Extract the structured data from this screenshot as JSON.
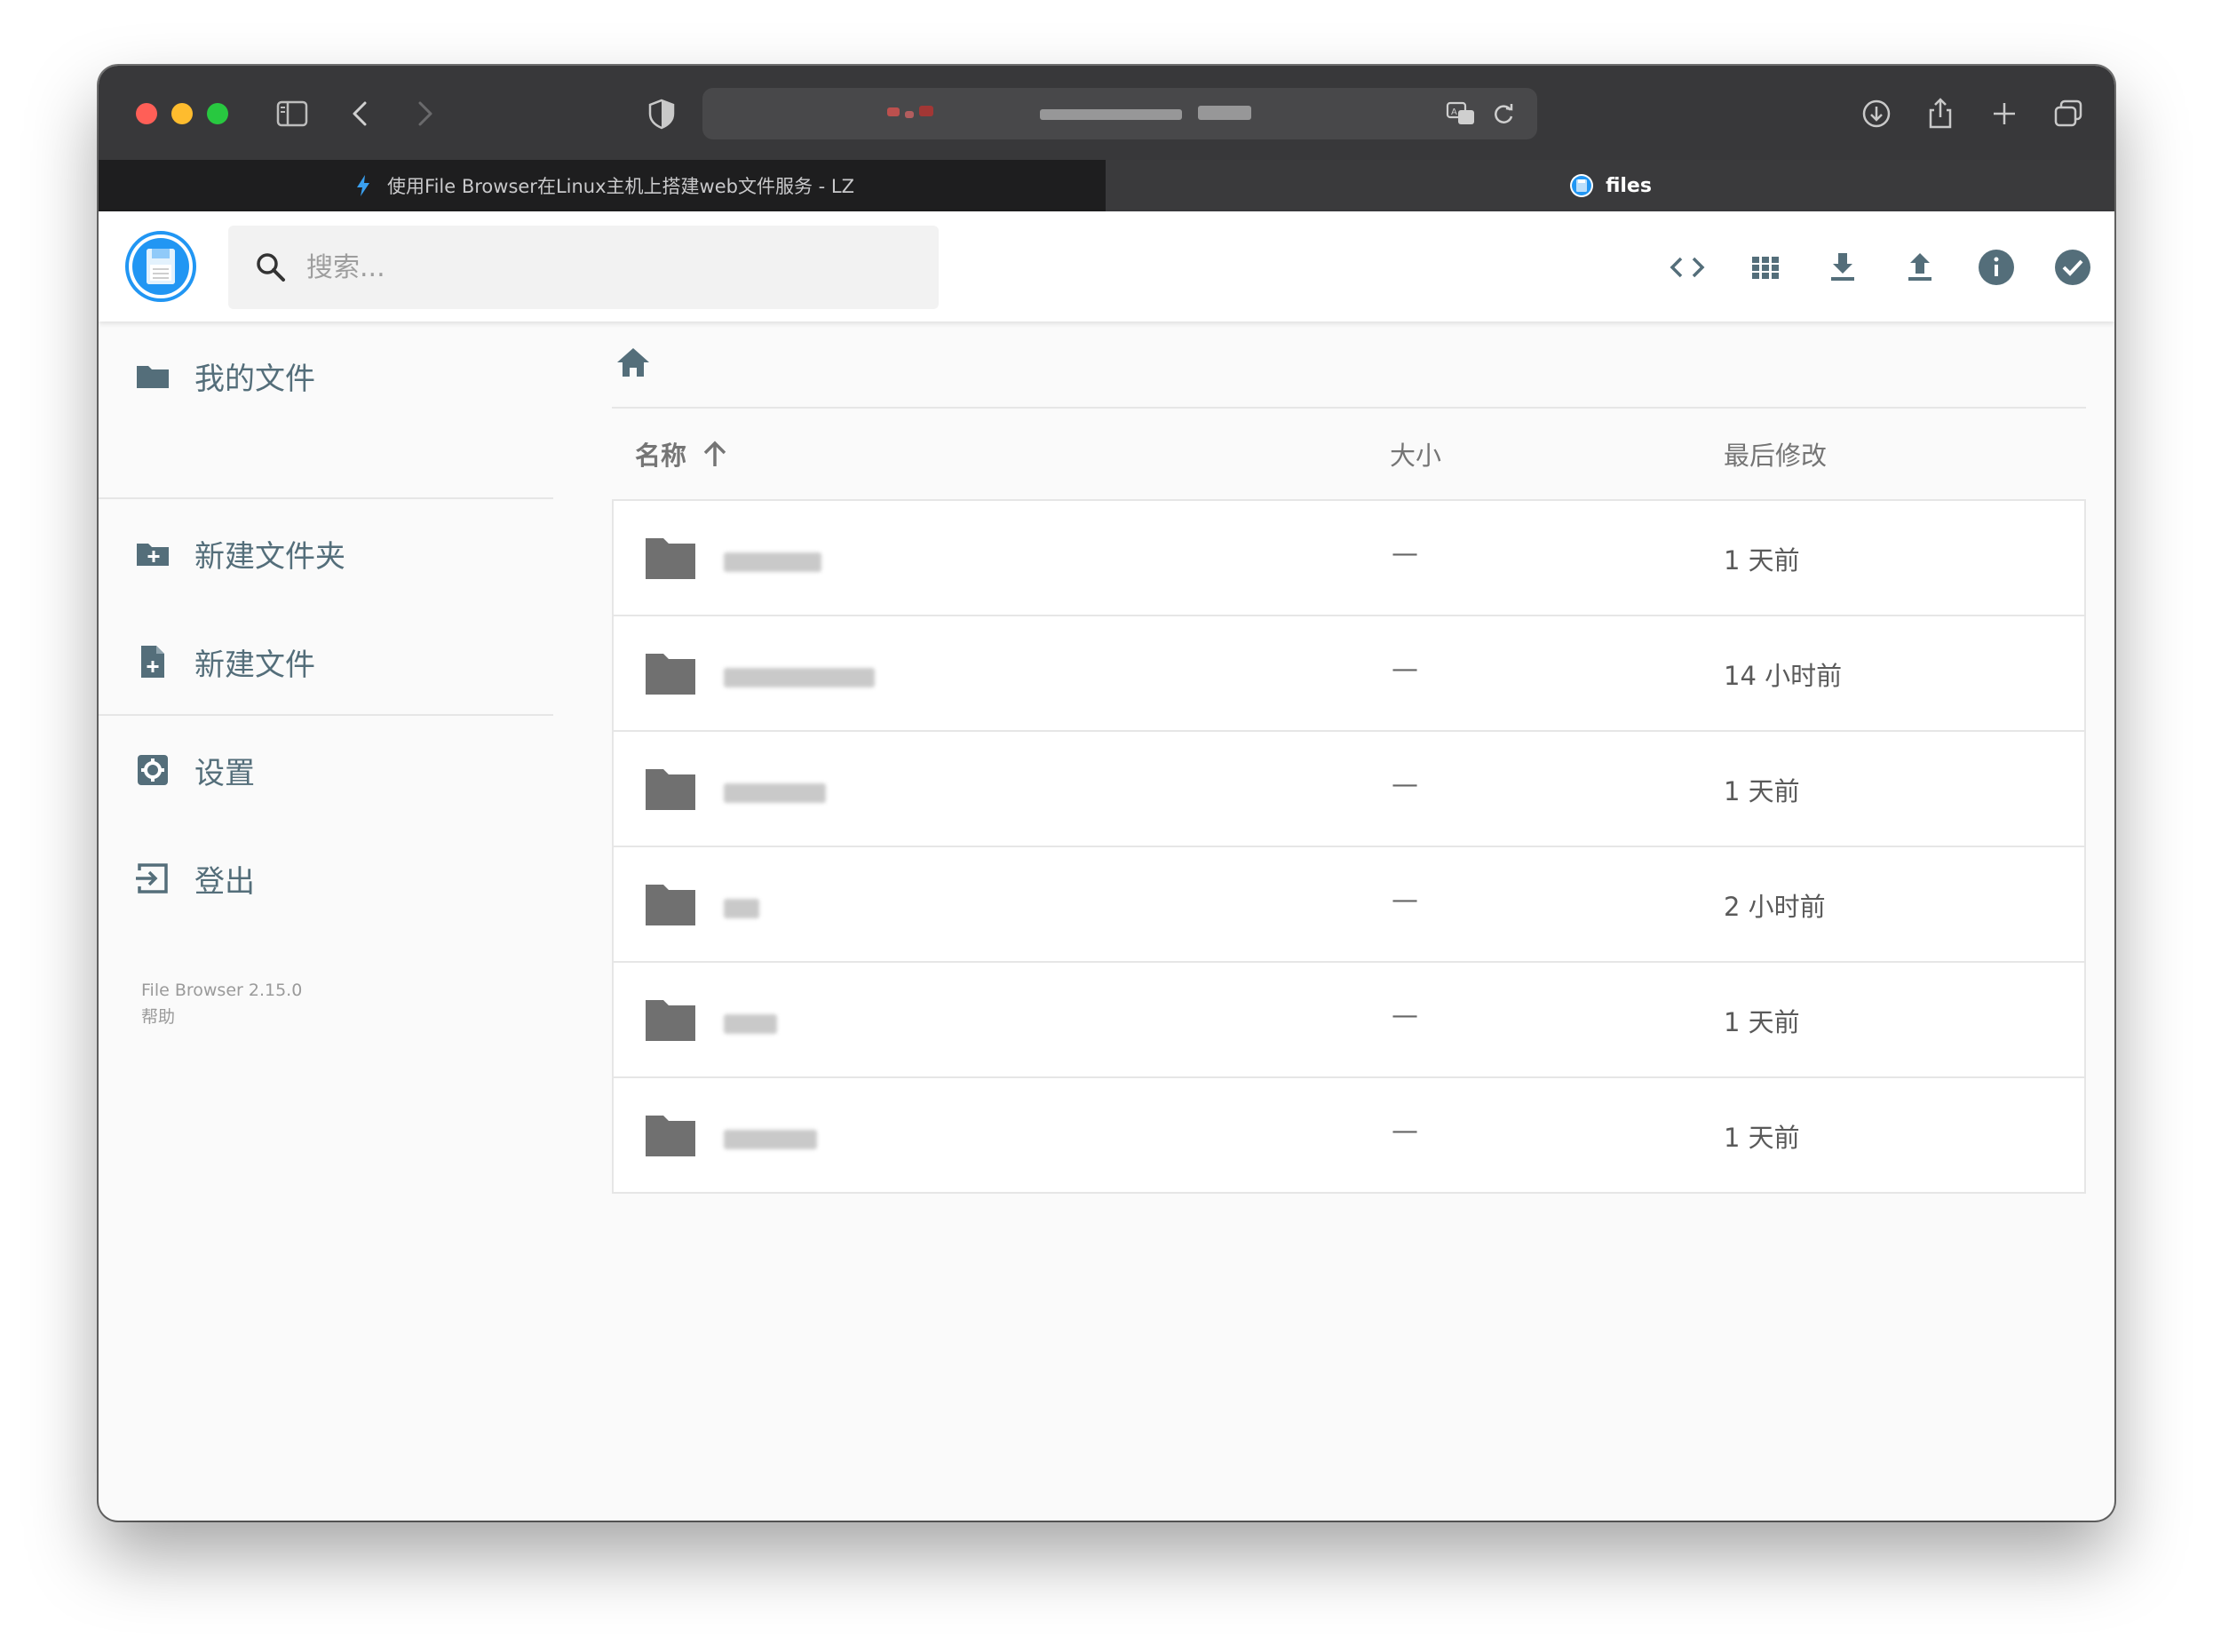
{
  "browser": {
    "tabs": [
      {
        "label": "使用File Browser在Linux主机上搭建web文件服务 - LZ",
        "active": false
      },
      {
        "label": "files",
        "active": true
      }
    ],
    "icons": [
      "sidebar-icon",
      "back-icon",
      "forward-icon",
      "shield-icon",
      "translate-icon",
      "reload-icon",
      "download-icon",
      "share-icon",
      "plus-icon",
      "tabs-overview-icon"
    ]
  },
  "header": {
    "search_placeholder": "搜索...",
    "icons": [
      "code-view-icon",
      "grid-view-icon",
      "download-icon",
      "upload-icon",
      "info-icon",
      "select-icon"
    ]
  },
  "sidebar": {
    "items": [
      {
        "label": "我的文件",
        "icon": "folder-icon"
      },
      {
        "label": "新建文件夹",
        "icon": "create-folder-icon"
      },
      {
        "label": "新建文件",
        "icon": "note-add-icon"
      },
      {
        "label": "设置",
        "icon": "settings-icon"
      },
      {
        "label": "登出",
        "icon": "logout-icon"
      }
    ],
    "version": "File Browser 2.15.0",
    "help": "帮助"
  },
  "listing": {
    "columns": {
      "name": "名称",
      "size": "大小",
      "modified": "最后修改"
    },
    "rows": [
      {
        "name": "",
        "size": "—",
        "modified": "1 天前"
      },
      {
        "name": "",
        "size": "—",
        "modified": "14 小时前"
      },
      {
        "name": "",
        "size": "—",
        "modified": "1 天前"
      },
      {
        "name": "",
        "size": "—",
        "modified": "2 小时前"
      },
      {
        "name": "",
        "size": "—",
        "modified": "1 天前"
      },
      {
        "name": "",
        "size": "—",
        "modified": "1 天前"
      }
    ]
  },
  "colors": {
    "accent": "#2196f3",
    "sidebar_text": "#546e7a",
    "icon_gray": "#6f6f6f"
  }
}
